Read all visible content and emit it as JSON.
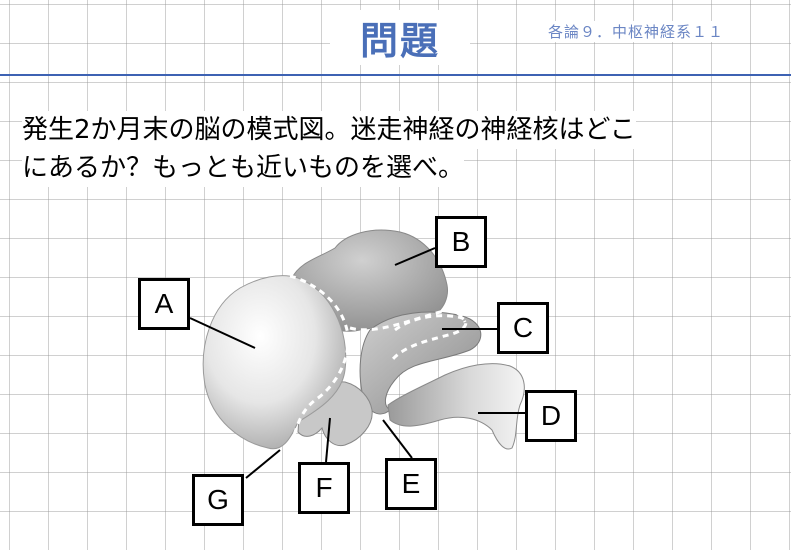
{
  "header": {
    "title": "問題",
    "subtitle": "各論９．中枢神経系１１"
  },
  "question": {
    "line1": "発生2か月末の脳の模式図。迷走神経の神経核はどこ",
    "line2": "にあるか？もっとも近いものを選べ。"
  },
  "figure": {
    "labels": {
      "A": "A",
      "B": "B",
      "C": "C",
      "D": "D",
      "E": "E",
      "F": "F",
      "G": "G"
    }
  },
  "colors": {
    "title": "#4a6fb8",
    "rule": "#3d62b3"
  }
}
